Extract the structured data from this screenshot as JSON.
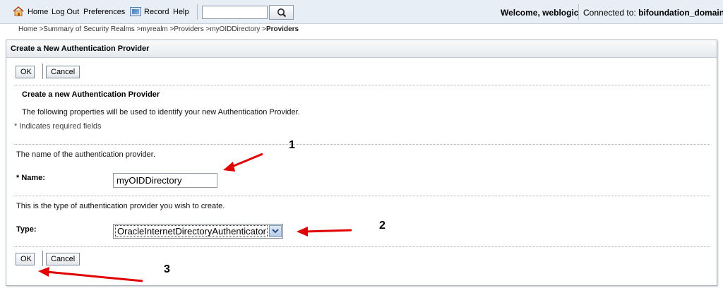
{
  "header": {
    "links": {
      "home": "Home",
      "logout": "Log Out",
      "preferences": "Preferences",
      "record": "Record",
      "help": "Help"
    },
    "search": {
      "value": "",
      "placeholder": ""
    },
    "welcome": "Welcome, weblogic",
    "connected_label": "Connected to:",
    "connected_domain": "bifoundation_domain"
  },
  "breadcrumb": {
    "items": [
      "Home >",
      "Summary of Security Realms >",
      "myrealm >",
      "Providers >",
      "myOIDDirectory >"
    ],
    "current": "Providers"
  },
  "panel": {
    "title": "Create a New Authentication Provider",
    "ok_label": "OK",
    "cancel_label": "Cancel",
    "section_title": "Create a new Authentication Provider",
    "intro": "The following properties will be used to identify your new Authentication Provider.",
    "required_note": "* Indicates required fields",
    "name_help": "The name of the authentication provider.",
    "name_label": "* Name:",
    "name_value": "myOIDDirectory",
    "type_help": "This is the type of authentication provider you wish to create.",
    "type_label": "Type:",
    "type_value": "OracleInternetDirectoryAuthenticator"
  },
  "annotations": [
    "1",
    "2",
    "3"
  ],
  "colors": {
    "topbar_bg": "#e7eef6",
    "arrow_red": "#e00000"
  },
  "icons": [
    "home-icon",
    "record-icon",
    "search-icon",
    "chevron-down-icon"
  ]
}
